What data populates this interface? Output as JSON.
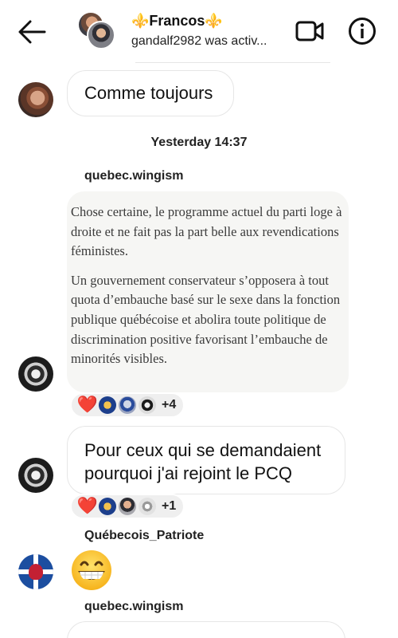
{
  "header": {
    "title": "⚜️Francos⚜️",
    "status": "gandalf2982 was activ..."
  },
  "messages": {
    "m1": {
      "text": "Comme toujours"
    },
    "timestamp": "Yesterday 14:37",
    "post": {
      "sender": "quebec.wingism",
      "paragraph1": "Chose certaine, le programme actuel du parti loge à droite et ne fait pas la part belle aux revendications féministes.",
      "paragraph2": "Un gouvernement conservateur s’opposera à tout quota d’embauche basé sur le sexe dans la fonction publique québécoise et abolira toute politique de discrimination positive favorisant l’embauche de minorités visibles.",
      "reactions": {
        "heart": "❤️",
        "count": "+4"
      }
    },
    "m3": {
      "text": "Pour ceux qui se demandaient pourquoi j'ai rejoint le PCQ",
      "reactions": {
        "heart": "❤️",
        "count": "+1"
      }
    },
    "m4": {
      "sender": "Québecois_Patriote",
      "emoji": "grinning-face"
    },
    "m5": {
      "sender": "quebec.wingism"
    }
  },
  "colors": {
    "bubble_border": "#e6e6e6",
    "post_background": "#f6f6f4",
    "reaction_pill": "#efefef",
    "heart_red": "#e0172c"
  }
}
